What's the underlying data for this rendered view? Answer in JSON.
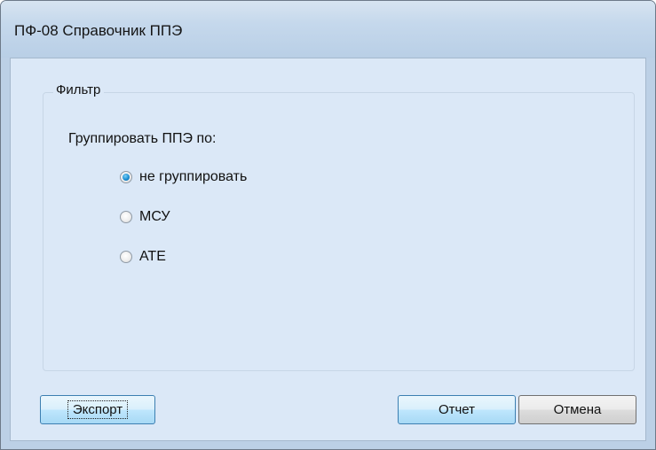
{
  "window": {
    "title": "ПФ-08 Справочник ППЭ"
  },
  "filter": {
    "legend": "Фильтр",
    "group_label": "Группировать ППЭ по:",
    "options": [
      {
        "label": "не группировать",
        "checked": true
      },
      {
        "label": "МСУ",
        "checked": false
      },
      {
        "label": "АТЕ",
        "checked": false
      }
    ]
  },
  "buttons": {
    "export": "Экспорт",
    "report": "Отчет",
    "cancel": "Отмена"
  }
}
